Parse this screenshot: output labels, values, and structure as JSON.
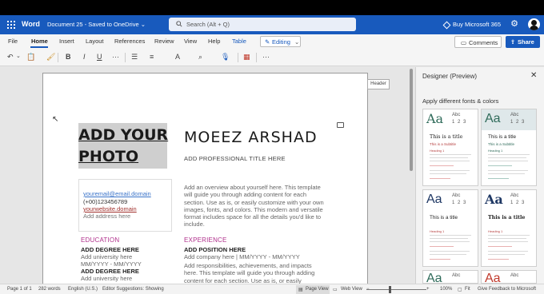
{
  "titlebar": {
    "app_name": "Word",
    "doc_title": "Document 25 - Saved to OneDrive ⌄",
    "search_placeholder": "Search (Alt + Q)",
    "buy_label": "Buy Microsoft 365",
    "colors": {
      "bar": "#185abd",
      "black_strip": "#000000"
    }
  },
  "menu": {
    "tabs": [
      "File",
      "Home",
      "Insert",
      "Layout",
      "References",
      "Review",
      "View",
      "Help",
      "Table"
    ],
    "active_tab": "Home",
    "editing_label": "Editing",
    "comments_label": "Comments",
    "share_label": "Share"
  },
  "toolbar": {
    "icons": [
      "undo-icon",
      "paste-icon",
      "format-painter-icon",
      "bold-icon",
      "italic-icon",
      "underline-icon",
      "more-icon",
      "bullets-icon",
      "align-icon",
      "styles-icon",
      "find-icon",
      "dictate-icon",
      "designer-icon",
      "more-options-icon"
    ]
  },
  "document": {
    "header_tag": "Header",
    "photo_placeholder": "ADD YOUR PHOTO",
    "name": "MOEEZ ARSHAD",
    "professional_title": "ADD PROFESSIONAL TITLE HERE",
    "contact": {
      "email": "youremail@email.domain",
      "phone": "(+00)123456789",
      "website": "yourwebsite.domain",
      "address": "Add address here"
    },
    "overview": "Add an overview about yourself here. This template will guide you through adding content for each section. Use as is, or easily customize with your own images, fonts, and colors. This modern and versatile format includes space for all the details you'd like to include.",
    "education": {
      "title": "EDUCATION",
      "entries": [
        {
          "degree": "ADD DEGREE HERE",
          "school": "Add university here",
          "dates": "MM/YYYY - MM/YYYY"
        },
        {
          "degree": "ADD DEGREE HERE",
          "school": "Add university here",
          "dates": ""
        }
      ]
    },
    "experience": {
      "title": "EXPERIENCE",
      "position": "ADD POSITION HERE",
      "company_line": "Add company here | MM/YYYY - MM/YYYY",
      "description": "Add responsibilities, achievements, and impacts here. This template will guide you through adding content for each section. Use as is, or easily"
    },
    "accent_color": "#b0308c"
  },
  "designer": {
    "title": "Designer (Preview)",
    "subtitle": "Apply different fonts & colors",
    "cards": [
      {
        "aa": "Aa",
        "abc": "Abc",
        "nums": "1 2 3",
        "title": "This is a title",
        "subtitle": "This is a Subtitle",
        "heading": "Heading 1",
        "aa_color": "#2f6b5a"
      },
      {
        "aa": "Aa",
        "abc": "Abc",
        "nums": "1 2 3",
        "title": "This is a title",
        "subtitle": "This is a Subtitle",
        "heading": "Heading 1",
        "aa_color": "#2f6b5a"
      },
      {
        "aa": "Aa",
        "abc": "Abc",
        "nums": "1 2 3",
        "title": "This is a title",
        "subtitle": "",
        "heading": "Heading 1",
        "aa_color": "#1f3864"
      },
      {
        "aa": "Aa",
        "abc": "Abc",
        "nums": "1 2 3",
        "title": "This is a title",
        "subtitle": "",
        "heading": "Heading 1",
        "aa_color": "#1f3864"
      },
      {
        "aa": "Aa",
        "abc": "Abc",
        "nums": "1 2 3",
        "title": "",
        "subtitle": "",
        "heading": "",
        "aa_color": "#2f6b5a"
      },
      {
        "aa": "Aa",
        "abc": "Abc",
        "nums": "1 2 3",
        "title": "",
        "subtitle": "",
        "heading": "",
        "aa_color": "#c0392b"
      }
    ]
  },
  "statusbar": {
    "page": "Page 1 of 1",
    "words": "282 words",
    "language": "English (U.S.)",
    "suggestions": "Editor Suggestions: Showing",
    "page_view": "Page View",
    "web_view": "Web View",
    "zoom_minus": "−",
    "zoom_plus": "+",
    "zoom": "100%",
    "fit": "Fit",
    "feedback": "Give Feedback to Microsoft"
  }
}
